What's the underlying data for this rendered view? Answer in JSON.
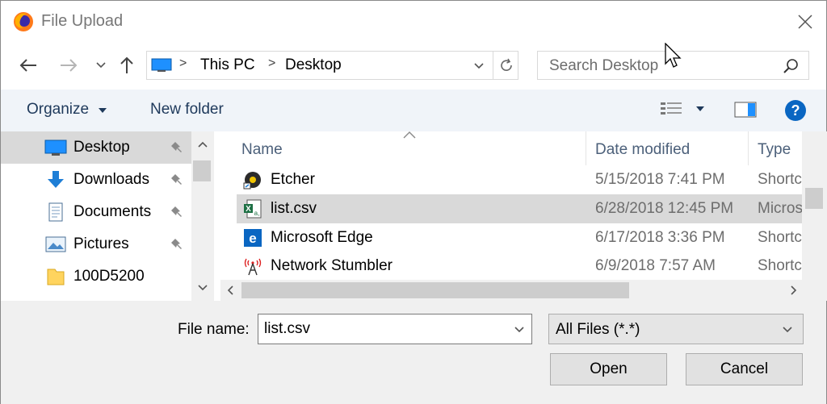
{
  "window": {
    "title": "File Upload"
  },
  "address": {
    "crumbs": [
      "This PC",
      "Desktop"
    ]
  },
  "search": {
    "placeholder": "Search Desktop"
  },
  "toolbar": {
    "organize": "Organize",
    "new_folder": "New folder"
  },
  "nav": {
    "items": [
      {
        "label": "Desktop",
        "icon": "desktop-icon",
        "pinned": true,
        "selected": true
      },
      {
        "label": "Downloads",
        "icon": "download-arrow-icon",
        "pinned": true
      },
      {
        "label": "Documents",
        "icon": "document-icon",
        "pinned": true
      },
      {
        "label": "Pictures",
        "icon": "picture-icon",
        "pinned": true
      },
      {
        "label": "100D5200",
        "icon": "folder-icon",
        "pinned": false
      }
    ]
  },
  "files": {
    "columns": {
      "name": "Name",
      "date": "Date modified",
      "type": "Type"
    },
    "rows": [
      {
        "name": "Etcher",
        "date": "5/15/2018 7:41 PM",
        "type": "Shortcut",
        "icon": "etcher-shortcut-icon"
      },
      {
        "name": "list.csv",
        "date": "6/28/2018 12:45 PM",
        "type": "Microsoft",
        "icon": "excel-csv-icon",
        "selected": true
      },
      {
        "name": "Microsoft Edge",
        "date": "6/17/2018 3:36 PM",
        "type": "Shortcut",
        "icon": "edge-icon"
      },
      {
        "name": "Network Stumbler",
        "date": "6/9/2018 7:57 AM",
        "type": "Shortcut",
        "icon": "network-stumbler-icon"
      }
    ]
  },
  "bottom": {
    "filename_label": "File name:",
    "filename_value": "list.csv",
    "filetype": "All Files (*.*)",
    "open_label": "Open",
    "cancel_label": "Cancel"
  },
  "colors": {
    "accent": "#0078d7",
    "selection": "#d9d9d9",
    "toolbar_bg": "#f0f4f9",
    "link_text": "#1e395b"
  }
}
